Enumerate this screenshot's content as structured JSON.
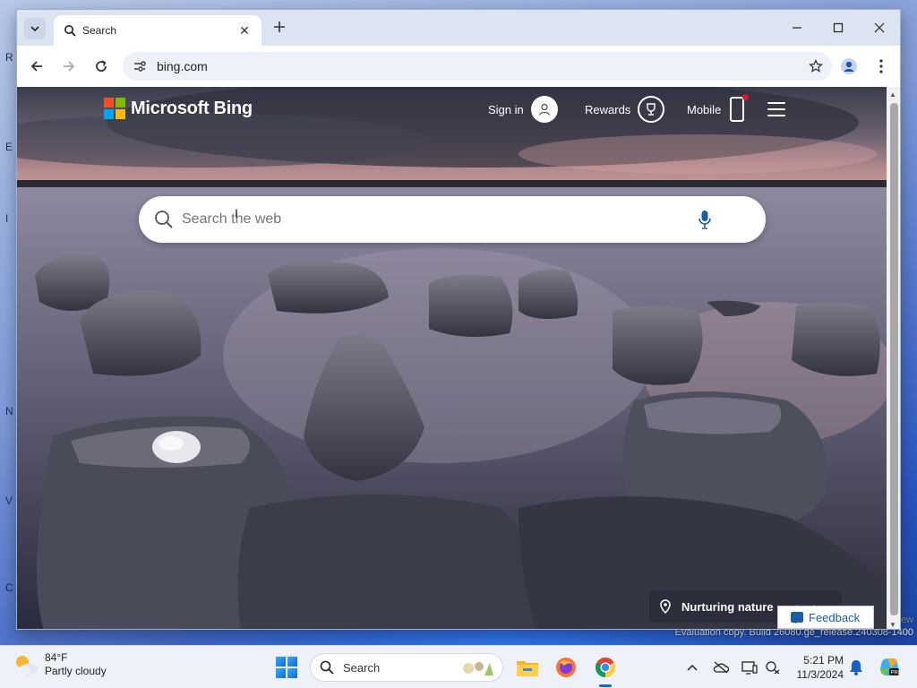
{
  "desktop": {
    "edge_letters": [
      "R",
      "E",
      "I",
      "N",
      "V",
      "C"
    ],
    "evaluation_text": "Evaluation copy. Build 26080.ge_release.240308-1400",
    "ghost_text": "ew"
  },
  "browser": {
    "tab_title": "Search",
    "url": "bing.com",
    "icons": {
      "tab_search": "chevron-down-icon",
      "tab_favicon": "search-icon",
      "tab_close": "close-icon",
      "new_tab": "plus-icon",
      "back": "arrow-left-icon",
      "forward": "arrow-right-icon",
      "reload": "reload-icon",
      "site_info": "tune-icon",
      "bookmark": "star-icon",
      "profile": "profile-icon",
      "menu": "kebab-menu-icon"
    }
  },
  "bing": {
    "logo_text": "Microsoft Bing",
    "sign_in": "Sign in",
    "rewards": "Rewards",
    "mobile": "Mobile",
    "search_placeholder": "Search the web",
    "caption": "Nurturing nature",
    "feedback": "Feedback",
    "colors": {
      "ms_red": "#f25022",
      "ms_green": "#7fba00",
      "ms_blue": "#00a4ef",
      "ms_yellow": "#ffb900",
      "mic_blue": "#1a5ea8"
    }
  },
  "taskbar": {
    "temperature": "84°F",
    "condition": "Partly cloudy",
    "search_label": "Search",
    "time": "5:21 PM",
    "date": "11/3/2024",
    "apps": [
      "start-icon",
      "file-explorer-icon",
      "firefox-icon",
      "chrome-icon"
    ],
    "tray_icons": [
      "chevron-up-icon",
      "onedrive-icon",
      "display-icon",
      "network-icon",
      "notification-bell-icon",
      "copilot-icon"
    ]
  }
}
